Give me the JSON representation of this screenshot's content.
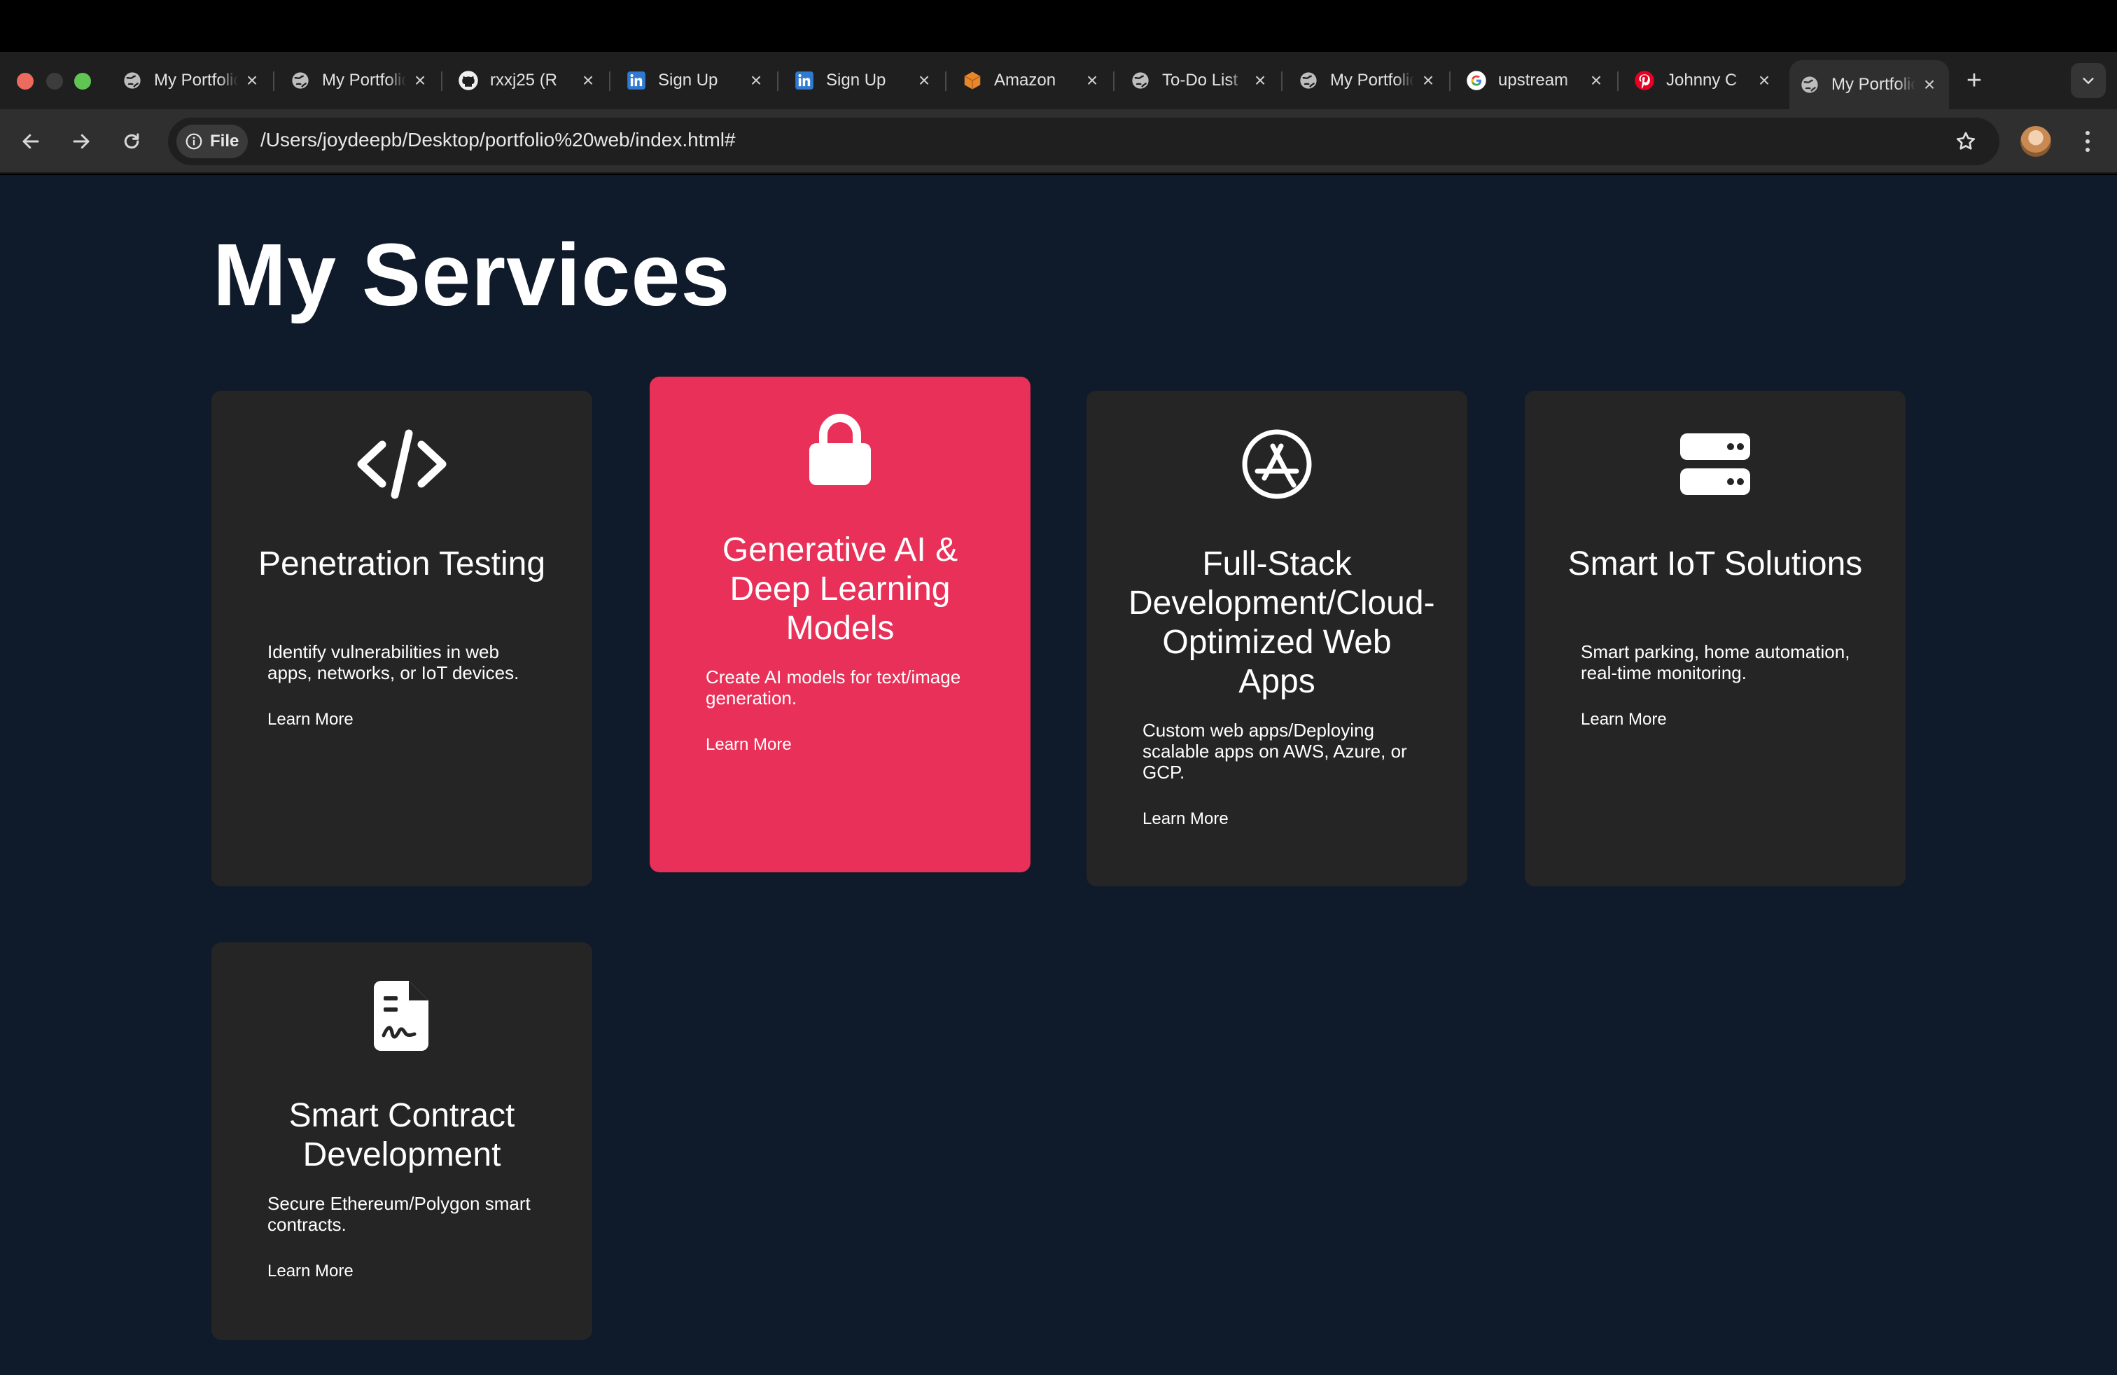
{
  "browser": {
    "tabs": [
      {
        "title": "My Portfolio",
        "icon": "globe-icon"
      },
      {
        "title": "My Portfolio",
        "icon": "globe-icon"
      },
      {
        "title": "rxxj25 (R",
        "icon": "github-icon"
      },
      {
        "title": "Sign Up",
        "icon": "linkedin-icon"
      },
      {
        "title": "Sign Up",
        "icon": "linkedin-icon"
      },
      {
        "title": "Amazon",
        "icon": "amazon-box-icon"
      },
      {
        "title": "To-Do List",
        "icon": "globe-icon"
      },
      {
        "title": "My Portfolio",
        "icon": "globe-icon"
      },
      {
        "title": "upstream",
        "icon": "google-icon"
      },
      {
        "title": "Johnny C",
        "icon": "pinterest-icon"
      },
      {
        "title": "My Portfolio",
        "icon": "globe-icon",
        "active": true
      }
    ],
    "file_label": "File",
    "url": "/Users/joydeepb/Desktop/portfolio%20web/index.html#"
  },
  "page": {
    "title": "My Services",
    "services": [
      {
        "icon": "code-icon",
        "title": "Penetration Testing",
        "description": "Identify vulnerabilities in web apps, networks, or IoT devices.",
        "link": "Learn More"
      },
      {
        "icon": "lock-icon",
        "title": "Generative AI & Deep Learning Models",
        "description": "Create AI models for text/image generation.",
        "link": "Learn More",
        "highlighted": true
      },
      {
        "icon": "app-store-icon",
        "title": "Full-Stack Development/Cloud-Optimized Web Apps",
        "description": "Custom web apps/Deploying scalable apps on AWS, Azure, or GCP.",
        "link": "Learn More"
      },
      {
        "icon": "server-icon",
        "title": "Smart IoT Solutions",
        "description": "Smart parking, home automation, real-time monitoring.",
        "link": "Learn More"
      },
      {
        "icon": "contract-file-icon",
        "title": "Smart Contract Development",
        "description": "Secure Ethereum/Polygon smart contracts.",
        "link": "Learn More"
      }
    ]
  },
  "colors": {
    "page_background": "#0f1a2a",
    "card_background": "#252525",
    "card_highlight": "#e83058"
  }
}
